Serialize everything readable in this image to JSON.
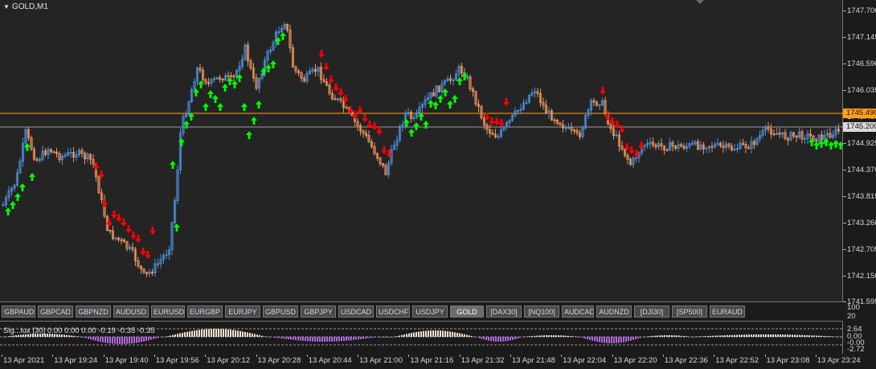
{
  "chart": {
    "title": "GOLD,M1",
    "bid_price": "1745.200",
    "ask_price": "1745.490",
    "colors": {
      "bull": "#4c8ed9",
      "bear": "#f0945a",
      "buy_arrow": "#00ff00",
      "sell_arrow": "#ff0000",
      "ask_line": "#ff9f1a",
      "bid_line": "#9a9a9a",
      "osc_pos": "#ffe4cf",
      "osc_neg": "#b267e0"
    }
  },
  "price_axis": {
    "labels": [
      "1747.700",
      "1747.145",
      "1746.590",
      "1746.035",
      "1745.480",
      "1744.925",
      "1744.370",
      "1743.815",
      "1743.260",
      "1742.705",
      "1742.150",
      "1741.595"
    ]
  },
  "symbol_bar": {
    "buttons": [
      "GBPAUD",
      "GBPCAD",
      "GBPNZD",
      "AUDUSD",
      "EURUSD",
      "EURGBP",
      "EURJPY",
      "GBPUSD",
      "GBPJPY",
      "USDCAD",
      "USDCHF",
      "USDJPY",
      "GOLD",
      "[DAX30]",
      "[NQ100]",
      "AUDCAD",
      "AUDNZD",
      "[DJI30]",
      "[SP500]",
      "EURAUD"
    ],
    "active": "GOLD"
  },
  "oscillator": {
    "label": "Sig...lux [30] 0.00 0.00 0.00 -0.19 -0.35 -0.35",
    "scale_top": "100",
    "scale_mid": "20",
    "levels": [
      "2.64",
      "0.00",
      "-0.00",
      "-2.72"
    ]
  },
  "time_axis": {
    "labels": [
      "13 Apr 2021",
      "13 Apr 19:24",
      "13 Apr 19:40",
      "13 Apr 19:56",
      "13 Apr 20:12",
      "13 Apr 20:28",
      "13 Apr 20:44",
      "13 Apr 21:00",
      "13 Apr 21:16",
      "13 Apr 21:32",
      "13 Apr 21:48",
      "13 Apr 22:04",
      "13 Apr 22:20",
      "13 Apr 22:36",
      "13 Apr 22:52",
      "13 Apr 23:08",
      "13 Apr 23:24"
    ]
  }
}
